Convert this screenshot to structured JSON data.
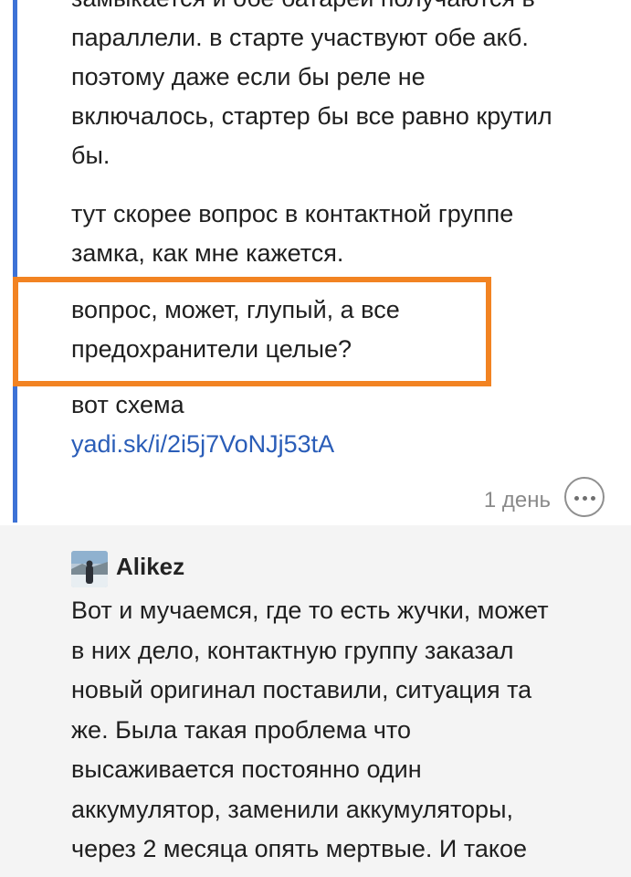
{
  "reply": {
    "lines_top": [
      "замыкается и обе батареи получаются в",
      "параллели. в старте участвуют обе акб.",
      "поэтому даже если бы реле не",
      "включалось, стартер бы все равно крутил",
      "бы."
    ],
    "lines_mid": [
      "тут скорее вопрос в контактной группе",
      "замка, как мне кажется."
    ],
    "lines_highlight": [
      "вопрос, может, глупый, а все",
      "предохранители целые?"
    ],
    "scheme_label": "вот схема",
    "link_text": "yadi.sk/i/2i5j7VoNJj53tA",
    "time": "1 день",
    "more_icon": "more-horizontal-icon",
    "highlight_color": "#f28322",
    "thread_color": "#3d72d6"
  },
  "comment": {
    "author": "Alikez",
    "lines": [
      "Вот и мучаемся, где то есть жучки, может",
      "в них дело, контактную группу заказал",
      "новый оригинал поставили, ситуация та",
      "же. Была такая проблема что",
      "высаживается постоянно один",
      "аккумулятор, заменили аккумуляторы,",
      "через 2 месяца опять мертвые. И такое"
    ]
  }
}
